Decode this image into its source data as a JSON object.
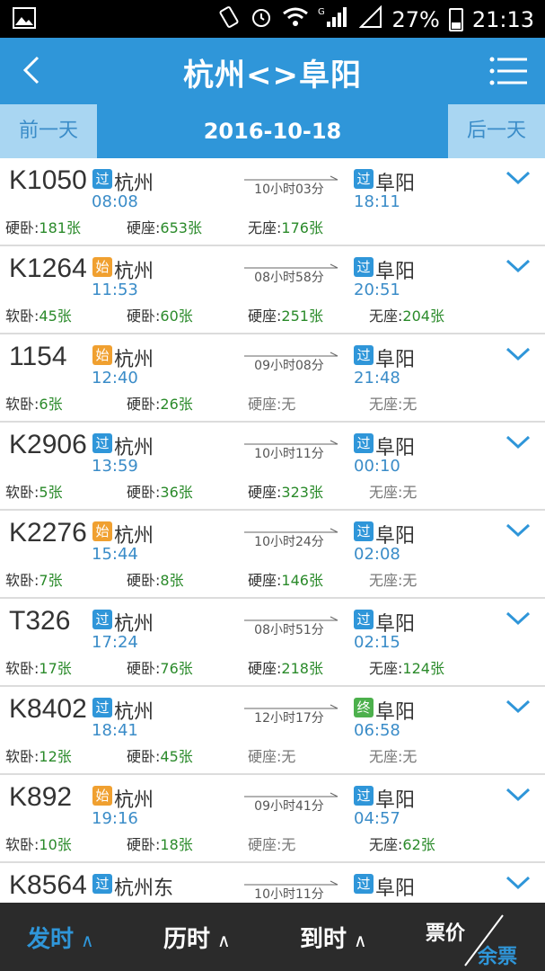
{
  "status_bar": {
    "signal_label": "G",
    "battery": "27%",
    "time": "21:13"
  },
  "header": {
    "title": "杭州<>阜阳",
    "back_icon": "chevron-left-icon",
    "menu_icon": "list-menu-icon"
  },
  "date_nav": {
    "prev": "前一天",
    "date": "2016-10-18",
    "next": "后一天"
  },
  "trains": [
    {
      "no": "K1050",
      "from_badge": "过",
      "from_type": "pass",
      "from": "杭州",
      "dep": "08:08",
      "duration": "10小时03分",
      "to_badge": "过",
      "to_type": "pass",
      "to": "阜阳",
      "arr": "18:11",
      "seats": [
        {
          "label": "硬卧:",
          "count": "181张"
        },
        {
          "label": "硬座:",
          "count": "653张"
        },
        {
          "label": "无座:",
          "count": "176张"
        }
      ]
    },
    {
      "no": "K1264",
      "from_badge": "始",
      "from_type": "start",
      "from": "杭州",
      "dep": "11:53",
      "duration": "08小时58分",
      "to_badge": "过",
      "to_type": "pass",
      "to": "阜阳",
      "arr": "20:51",
      "seats": [
        {
          "label": "软卧:",
          "count": "45张"
        },
        {
          "label": "硬卧:",
          "count": "60张"
        },
        {
          "label": "硬座:",
          "count": "251张"
        },
        {
          "label": "无座:",
          "count": "204张"
        }
      ]
    },
    {
      "no": "1154",
      "from_badge": "始",
      "from_type": "start",
      "from": "杭州",
      "dep": "12:40",
      "duration": "09小时08分",
      "to_badge": "过",
      "to_type": "pass",
      "to": "阜阳",
      "arr": "21:48",
      "seats": [
        {
          "label": "软卧:",
          "count": "6张"
        },
        {
          "label": "硬卧:",
          "count": "26张"
        },
        {
          "label": "硬座:",
          "count": "无"
        },
        {
          "label": "无座:",
          "count": "无"
        }
      ]
    },
    {
      "no": "K2906",
      "from_badge": "过",
      "from_type": "pass",
      "from": "杭州",
      "dep": "13:59",
      "duration": "10小时11分",
      "to_badge": "过",
      "to_type": "pass",
      "to": "阜阳",
      "arr": "00:10",
      "seats": [
        {
          "label": "软卧:",
          "count": "5张"
        },
        {
          "label": "硬卧:",
          "count": "36张"
        },
        {
          "label": "硬座:",
          "count": "323张"
        },
        {
          "label": "无座:",
          "count": "无"
        }
      ]
    },
    {
      "no": "K2276",
      "from_badge": "始",
      "from_type": "start",
      "from": "杭州",
      "dep": "15:44",
      "duration": "10小时24分",
      "to_badge": "过",
      "to_type": "pass",
      "to": "阜阳",
      "arr": "02:08",
      "seats": [
        {
          "label": "软卧:",
          "count": "7张"
        },
        {
          "label": "硬卧:",
          "count": "8张"
        },
        {
          "label": "硬座:",
          "count": "146张"
        },
        {
          "label": "无座:",
          "count": "无"
        }
      ]
    },
    {
      "no": "T326",
      "from_badge": "过",
      "from_type": "pass",
      "from": "杭州",
      "dep": "17:24",
      "duration": "08小时51分",
      "to_badge": "过",
      "to_type": "pass",
      "to": "阜阳",
      "arr": "02:15",
      "seats": [
        {
          "label": "软卧:",
          "count": "17张"
        },
        {
          "label": "硬卧:",
          "count": "76张"
        },
        {
          "label": "硬座:",
          "count": "218张"
        },
        {
          "label": "无座:",
          "count": "124张"
        }
      ]
    },
    {
      "no": "K8402",
      "from_badge": "过",
      "from_type": "pass",
      "from": "杭州",
      "dep": "18:41",
      "duration": "12小时17分",
      "to_badge": "终",
      "to_type": "end",
      "to": "阜阳",
      "arr": "06:58",
      "seats": [
        {
          "label": "软卧:",
          "count": "12张"
        },
        {
          "label": "硬卧:",
          "count": "45张"
        },
        {
          "label": "硬座:",
          "count": "无"
        },
        {
          "label": "无座:",
          "count": "无"
        }
      ]
    },
    {
      "no": "K892",
      "from_badge": "始",
      "from_type": "start",
      "from": "杭州",
      "dep": "19:16",
      "duration": "09小时41分",
      "to_badge": "过",
      "to_type": "pass",
      "to": "阜阳",
      "arr": "04:57",
      "seats": [
        {
          "label": "软卧:",
          "count": "10张"
        },
        {
          "label": "硬卧:",
          "count": "18张"
        },
        {
          "label": "硬座:",
          "count": "无"
        },
        {
          "label": "无座:",
          "count": "62张"
        }
      ]
    },
    {
      "no": "K8564",
      "from_badge": "过",
      "from_type": "pass",
      "from": "杭州东",
      "dep": "",
      "duration": "10小时11分",
      "to_badge": "过",
      "to_type": "pass",
      "to": "阜阳",
      "arr": "",
      "seats": []
    }
  ],
  "bottom_sort": {
    "departure": "发时",
    "duration": "历时",
    "arrival": "到时",
    "price": "票价",
    "remaining": "余票",
    "caret": "∧"
  },
  "colors": {
    "primary": "#2f96d9",
    "date_bar_light": "#a9d6f2",
    "badge_start": "#f0a030",
    "badge_end": "#4cb04c",
    "count_green": "#2a8a2a",
    "bottom_bar": "#2b2b2b"
  }
}
